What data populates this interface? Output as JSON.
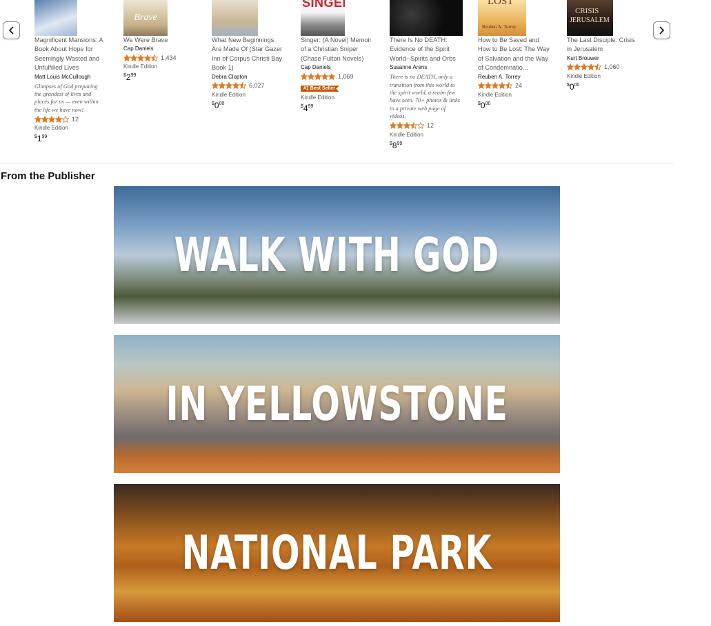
{
  "nav": {
    "prev_icon": "chevron-left-icon",
    "next_icon": "chevron-right-icon"
  },
  "products": [
    {
      "title_lines": [
        "Magnificent Mansions: A",
        "Book About Hope for",
        "Seemingly Wasted and",
        "Unfulfilled Lives"
      ],
      "author": "Matt Louis McCullough",
      "desc_lines": [
        "Glimpses of God preparing",
        "the grandest of lives and",
        "places for us — even within",
        "the life we have now!"
      ],
      "stars": 4,
      "rating_count": "12",
      "format": "Kindle Edition",
      "price": {
        "currency": "$",
        "whole": "1",
        "fraction": "99"
      },
      "cover_color": "#6e8fb8"
    },
    {
      "title_lines": [
        "We Were Brave"
      ],
      "author": "Cap Daniels",
      "stars": 4.5,
      "rating_count": "1,434",
      "format": "Kindle Edition",
      "price": {
        "currency": "$",
        "whole": "2",
        "fraction": "99"
      },
      "cover_text": "Brave",
      "cover_color": "#cbb68c"
    },
    {
      "title_lines": [
        "What New Beginnings",
        "Are Made Of (Star Gazer",
        "Inn of Corpus Christi Bay",
        "Book 1)"
      ],
      "author": "Debra Clopton",
      "stars": 4.5,
      "rating_count": "6,027",
      "format": "Kindle Edition",
      "price": {
        "currency": "$",
        "whole": "0",
        "fraction": "00"
      },
      "cover_color": "#d8cbb4"
    },
    {
      "title_lines": [
        "Singer: (A Novel) Memoir",
        "of a Christian Sniper",
        "(Chase Fulton Novels)"
      ],
      "author": "Cap Daniels",
      "stars": 5,
      "rating_count": "1,069",
      "badge": "#1 Best Seller",
      "format": "Kindle Edition",
      "price": {
        "currency": "$",
        "whole": "4",
        "fraction": "99"
      },
      "cover_text": "SINGER",
      "cover_color": "#9a9a9a"
    },
    {
      "title_lines": [
        "There Is No DEATH:",
        "Evidence of the Spirit",
        "World--Spirits and Orbs"
      ],
      "author": "Susanne Arens",
      "desc_lines": [
        "There is no DEATH, only a",
        "transition from this world to",
        "the spirit world, a realm few",
        "have seen. 70+ photos & links",
        "to a private web page of",
        "videos."
      ],
      "stars": 3.5,
      "rating_count": "12",
      "format": "Kindle Edition",
      "price": {
        "currency": "$",
        "whole": "8",
        "fraction": "99"
      },
      "cover_color": "#141414"
    },
    {
      "title_lines": [
        "How to Be Saved and",
        "How to Be Lost: The Way",
        "of Salvation and the Way",
        "of Condemnatio..."
      ],
      "author": "Reuben A. Torrey",
      "stars": 4.5,
      "rating_count": "24",
      "format": "Kindle Edition",
      "price": {
        "currency": "$",
        "whole": "0",
        "fraction": "00"
      },
      "cover_text": "LOST",
      "cover_subtext": "Reuben A. Torrey",
      "cover_color": "#e2b86a"
    },
    {
      "title_lines": [
        "The Last Disciple: Crisis",
        "in Jerusalem"
      ],
      "author": "Kurt Brouwer",
      "stars": 4.5,
      "rating_count": "1,060",
      "format": "Kindle Edition",
      "price": {
        "currency": "$",
        "whole": "0",
        "fraction": "00"
      },
      "cover_text": "CRISIS",
      "cover_subtext": "JERUSALEM",
      "cover_color": "#2a2a2a"
    }
  ],
  "section_title": "From the Publisher",
  "banners": [
    "WALK WITH GOD",
    "IN YELLOWSTONE",
    "NATIONAL PARK"
  ],
  "colors": {
    "star": "#de7921",
    "badge": "#c45500",
    "link_gray": "#565959"
  }
}
